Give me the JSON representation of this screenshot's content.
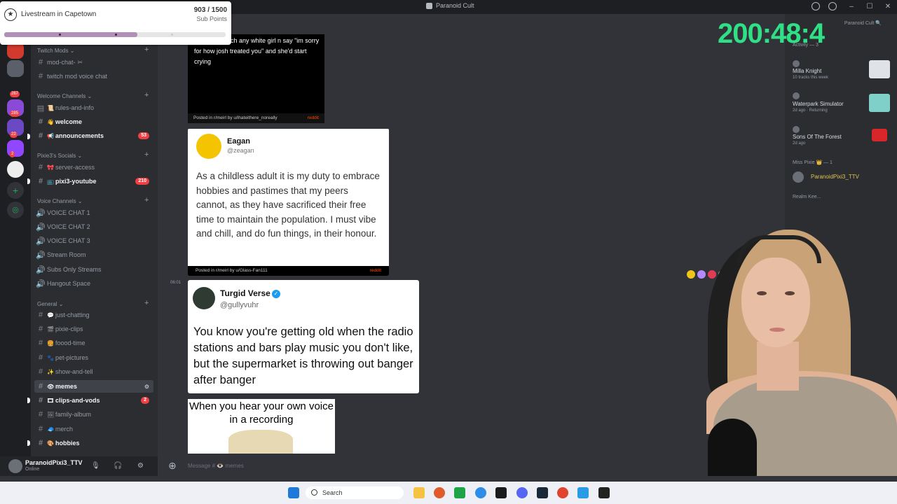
{
  "window": {
    "title": "Paranoid Cult",
    "minimize": "–",
    "maximize": "☐",
    "close": "✕"
  },
  "overlay": {
    "subgoal_title": "Livestream in Capetown",
    "subgoal_count": "903 / 1500",
    "subgoal_unit": "Sub Points",
    "subgoal_progress": 0.602,
    "timer": "200:48:4"
  },
  "rail": {
    "badges": [
      "267",
      "285",
      "22",
      "2"
    ]
  },
  "sidebar": {
    "categories": {
      "twitch_mods": "Twitch Mods",
      "welcome": "Welcome Channels",
      "socials": "Pixie3's Socials",
      "voice": "Voice Channels",
      "general": "General"
    },
    "channels": {
      "mod_chat": "mod-chat-",
      "twitch_mod_voice": "twitch mod voice chat",
      "rules": "rules-and-info",
      "welcome": "welcome",
      "announcements": "announcements",
      "announcements_badge": "53",
      "server_access": "server-access",
      "youtube": "pixi3-youtube",
      "youtube_badge": "210",
      "vc1": "VOICE CHAT 1",
      "vc2": "VOICE CHAT 2",
      "vc3": "VOICE CHAT 3",
      "stream_room": "Stream Room",
      "subs_only": "Subs Only Streams",
      "hangout": "Hangout Space",
      "just_chatting": "just-chatting",
      "pixie_clips": "pixie-clips",
      "food_time": "foood-time",
      "pet_pictures": "pet-pictures",
      "show_and_tell": "show-and-tell",
      "memes": "memes",
      "clips_vods": "clips-and-vods",
      "clips_vods_badge": "2",
      "family_album": "family-album",
      "merch": "merch",
      "hobbies": "hobbies"
    }
  },
  "user_panel": {
    "name": "ParanoidPixi3_TTV",
    "status": "Online"
  },
  "chat": {
    "input_placeholder": "Message # 👁️ memes",
    "reddit_post_1": {
      "text": "erally approach any white girl n say \"im sorry for how josh treated you\" and she'd start crying",
      "footer": "Posted in r/meirl by u/ihateithere_noreally",
      "brand": "reddit"
    },
    "tweet_1": {
      "name": "Eagan",
      "handle": "@zeagan",
      "body": "As a childless adult it is my duty to embrace hobbies and pastimes that my peers cannot, as they have sacrificed their free time to maintain the population. I must vibe and chill, and do fun things, in their honour.",
      "footer": "Posted in r/meirl by u/Glass-Fan111",
      "brand": "reddit"
    },
    "timestamp": "06:01",
    "tweet_2": {
      "name": "Turgid Verse",
      "handle": "@gullyvuhr",
      "body": "You know you're getting old when the radio stations and bars play music you don't like, but the supermarket is throwing out banger after banger"
    },
    "meme": {
      "caption": "When you hear your own voice in a recording"
    }
  },
  "members": {
    "search_label": "Paranoid Cult",
    "activity_header": "Activity — 3",
    "activity": [
      {
        "name": "Milla Knight",
        "sub": "10 tracks this week"
      },
      {
        "name": "Waterpark Simulator",
        "sub": "2d ago · Returning"
      },
      {
        "name": "Sons Of The Forest",
        "sub": "2d ago"
      }
    ],
    "role_header": "Miss Pixie 👑 — 1",
    "role_member": "ParanoidPixi3_TTV",
    "next_role": "Realm Kee..."
  },
  "taskbar": {
    "search_label": "Search"
  },
  "colors": {
    "accent_timer": "#2fe086",
    "progress_fill": "#b28fb8",
    "badge_red": "#f23f43",
    "reddit_orange": "#ff4500"
  }
}
